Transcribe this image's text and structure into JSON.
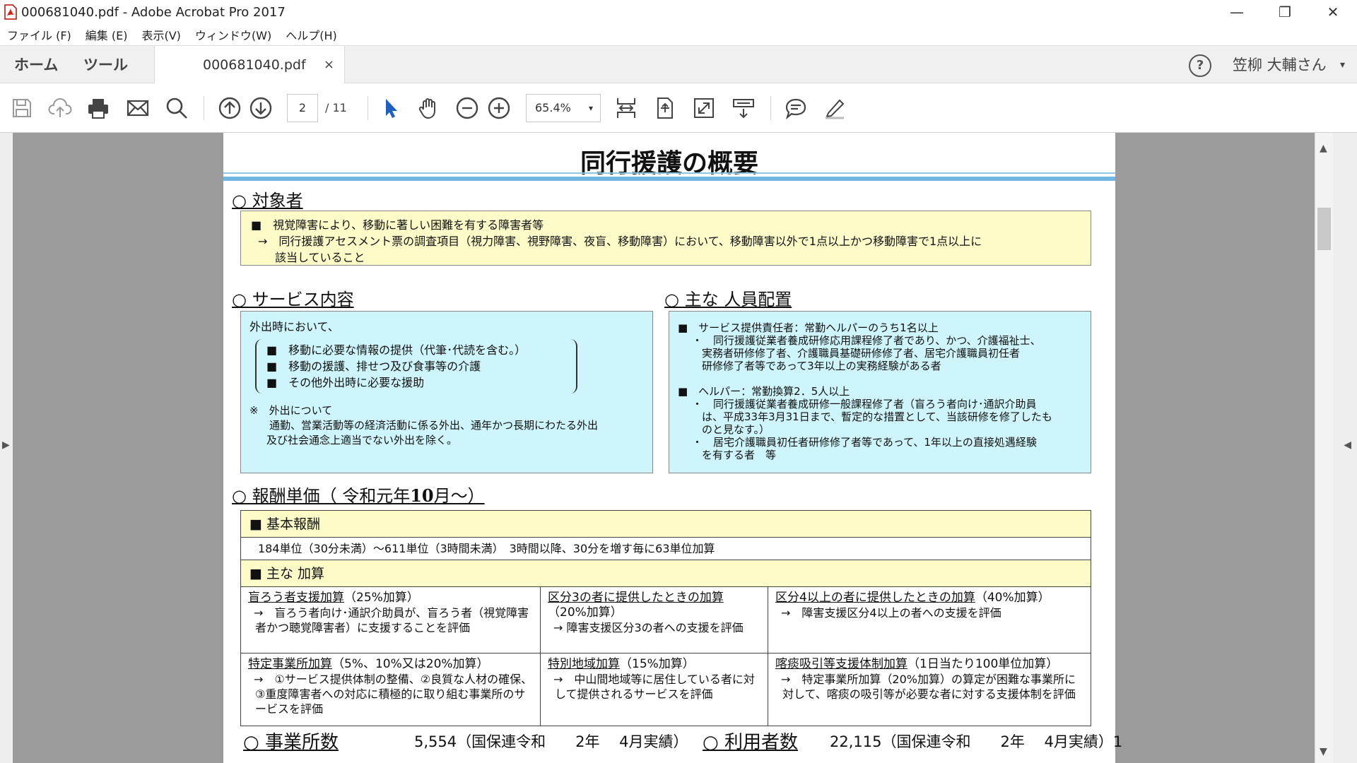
{
  "window": {
    "title": "000681040.pdf - Adobe Acrobat Pro 2017",
    "minimize": "—",
    "restore": "❐",
    "close": "✕"
  },
  "menu": [
    "ファイル (F)",
    "編集 (E)",
    "表示(V)",
    "ウィンドウ(W)",
    "ヘルプ(H)"
  ],
  "tabs": {
    "home": "ホーム",
    "tools": "ツール",
    "doc": "000681040.pdf",
    "doc_close": "×",
    "help": "?",
    "user": "笠柳 大輔さん",
    "user_caret": "▾"
  },
  "toolbar": {
    "page_current": "2",
    "page_total": "/ 11",
    "zoom": "65.4%",
    "zoom_caret": "▾",
    "icons": [
      "save-icon",
      "cloud-upload-icon",
      "print-icon",
      "email-icon",
      "search-icon",
      "previous-page-icon",
      "next-page-icon",
      "select-arrow-icon",
      "hand-icon",
      "zoom-out-icon",
      "zoom-in-icon",
      "fit-width-icon",
      "fit-page-icon",
      "full-screen-icon",
      "read-mode-icon",
      "comment-icon",
      "highlight-pen-icon"
    ]
  },
  "doc": {
    "title": "同行援護の概要",
    "target": {
      "heading": "○ 対象者",
      "lines": [
        "■　視覚障害により、移動に著しい困難を有する障害者等",
        "→　同行援護アセスメント票の調査項目（視力障害、視野障害、夜盲、移動障害）において、移動障害以外で1点以上かつ移動障害で1点以上に",
        "該当していること"
      ]
    },
    "service": {
      "heading": "○ サービス内容",
      "intro": "外出時において、",
      "items": [
        "■　移動に必要な情報の提供（代筆･代読を含む。）",
        "■　移動の援護、排せつ及び食事等の介護",
        "■　その他外出時に必要な援助"
      ],
      "note_lines": [
        "※　外出について",
        "通勤、営業活動等の経済活動に係る外出、通年かつ長期にわたる外出",
        "及び社会通念上適当でない外出を除く。"
      ]
    },
    "staff": {
      "heading": "○ 主な 人員配置",
      "lines": [
        "■　サービス提供責任者：常勤ヘルパーのうち1名以上",
        "・　同行援護従業者養成研修応用課程修了者であり、かつ、介護福祉士、",
        "実務者研修修了者、介護職員基礎研修修了者、居宅介護職員初任者",
        "研修修了者等であって3年以上の実務経験がある者",
        "■　ヘルパー：常勤換算2．5人以上",
        "・　同行援護従業者養成研修一般課程修了者（盲ろう者向け･通訳介助員",
        "は、平成33年3月31日まで、暫定的な措置として、当該研修を修了したも",
        "のと見なす。）",
        "・　居宅介護職員初任者研修修了者等であって、1年以上の直接処遇経験",
        "を有する者　等"
      ]
    },
    "fee": {
      "heading_prefix": "○ 報酬単価（ 令和元年",
      "heading_bold": "10",
      "heading_suffix": "月～）",
      "basic_label": "■ 基本報酬",
      "basic_value": "184単位（30分未満）～611単位（3時間未満）　3時間以降、30分を増す毎に63単位加算",
      "addon_label": "■ 主な 加算",
      "addons": [
        {
          "title": "盲ろう者支援加算",
          "rest": "（25%加算）",
          "desc": "→　盲ろう者向け･通訳介助員が、盲ろう者（視覚障害者かつ聴覚障害者）に支援することを評価"
        },
        {
          "title": "区分3の者に提供したときの加算",
          "rest": "（20%加算）",
          "desc": "→ 障害支援区分3の者への支援を評価"
        },
        {
          "title": "区分4以上の者に提供したときの加算",
          "rest": "（40%加算）",
          "desc": "→　障害支援区分4以上の者への支援を評価"
        },
        {
          "title": "特定事業所加算",
          "rest": "（5%、10%又は20%加算）",
          "desc": "→　①サービス提供体制の整備、②良質な人材の確保、③重度障害者への対応に積極的に取り組む事業所のサービスを評価"
        },
        {
          "title": "特別地域加算",
          "rest": "（15%加算）",
          "desc": "→　中山間地域等に居住している者に対して提供されるサービスを評価"
        },
        {
          "title": "喀痰吸引等支援体制加算",
          "rest": "（1日当たり100単位加算）",
          "desc": "→　特定事業所加算（20%加算）の算定が困難な事業所に対して、喀痰の吸引等が必要な者に対する支援体制を評価"
        }
      ]
    },
    "footer": {
      "offices_label": "○ 事業所数",
      "offices_value": "5,554（国保連令和　　2年　 4月実績）",
      "users_label": "○ 利用者数",
      "users_value": "22,115（国保連令和　　2年　 4月実績）1"
    }
  },
  "colors": {
    "yellow_box": "#fdfbc8",
    "cyan_box": "#cdf5fb",
    "title_rule": "#6fb6e3",
    "viewer_bg": "#9b9b9b",
    "select_arrow": "#1f5fbf"
  }
}
